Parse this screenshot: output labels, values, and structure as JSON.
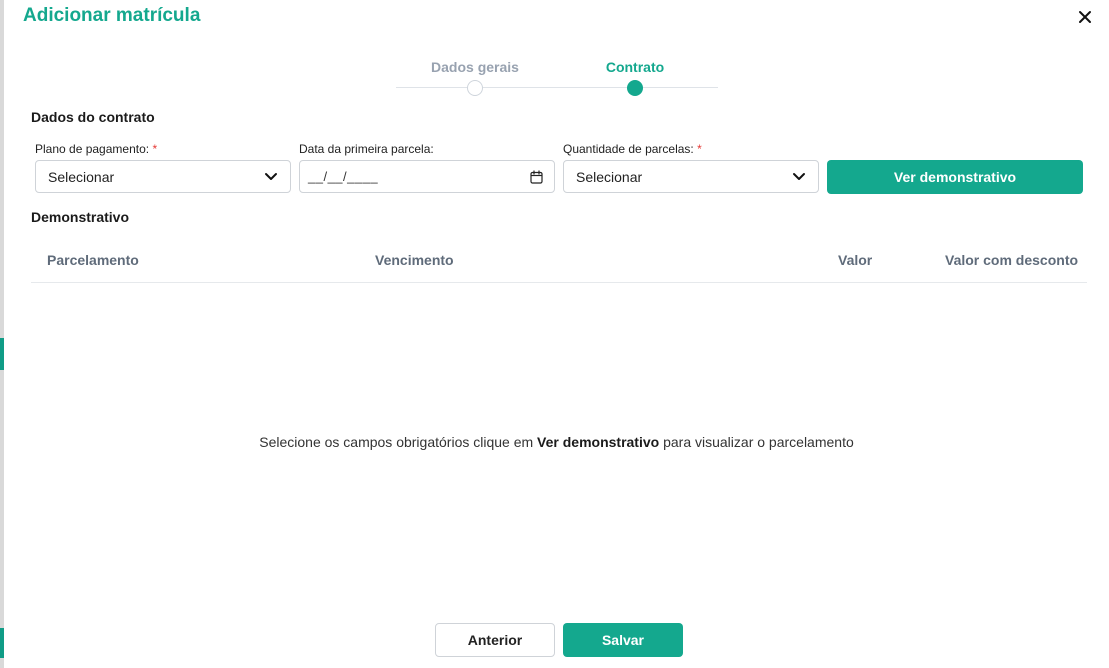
{
  "dialog": {
    "title": "Adicionar matrícula",
    "close_icon": "close-icon"
  },
  "stepper": {
    "steps": [
      {
        "label": "Dados gerais",
        "state": "inactive"
      },
      {
        "label": "Contrato",
        "state": "active"
      }
    ],
    "active_color": "#14a88e",
    "inactive_color": "#98a2b0"
  },
  "contract": {
    "section_title": "Dados do contrato",
    "payment_plan": {
      "label": "Plano de pagamento:",
      "required_mark": "*",
      "value": "Selecionar",
      "icon": "chevron-down-icon"
    },
    "first_installment_date": {
      "label": "Data da primeira parcela:",
      "value": "__/__/____",
      "icon": "calendar-icon"
    },
    "installments_qty": {
      "label": "Quantidade de parcelas:",
      "required_mark": "*",
      "value": "Selecionar",
      "icon": "chevron-down-icon"
    },
    "demo_button_label": "Ver demonstrativo"
  },
  "demonstrativo": {
    "section_title": "Demonstrativo",
    "columns": [
      "Parcelamento",
      "Vencimento",
      "Valor",
      "Valor com desconto"
    ],
    "empty_message": {
      "before": "Selecione os campos obrigatórios clique em ",
      "bold": "Ver demonstrativo",
      "after": " para visualizar o parcelamento"
    }
  },
  "footer": {
    "previous_label": "Anterior",
    "save_label": "Salvar"
  },
  "colors": {
    "accent": "#14a88e",
    "required": "#e53935"
  }
}
